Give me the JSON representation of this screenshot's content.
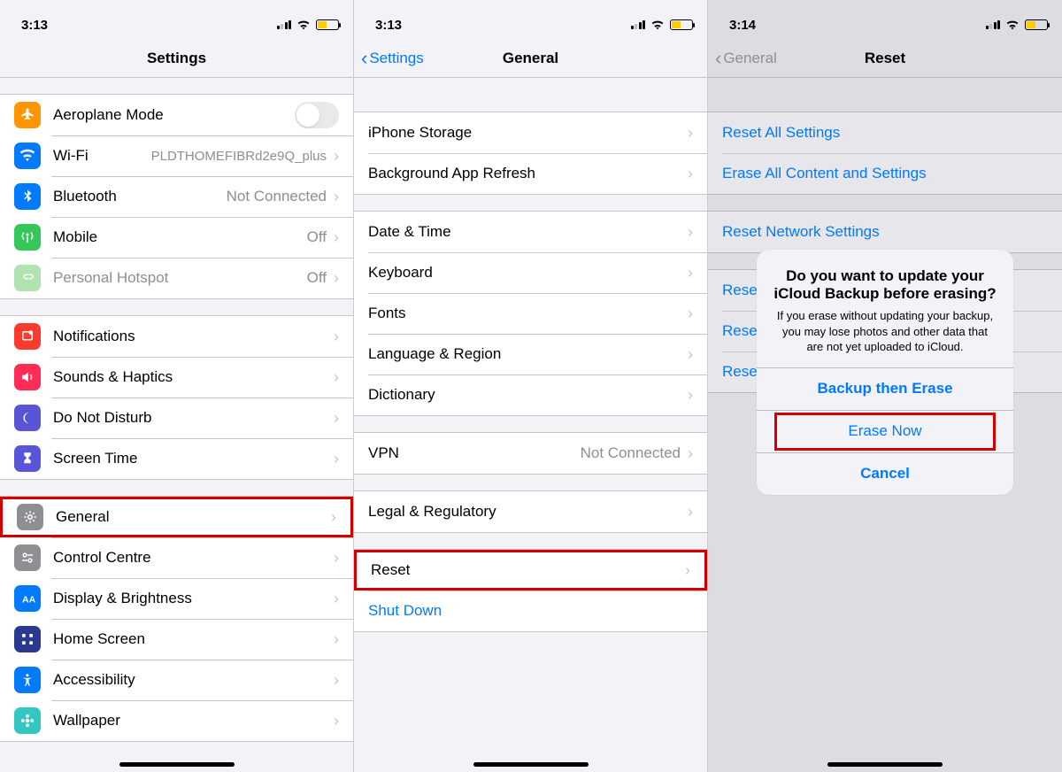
{
  "statusbar": {
    "time1": "3:13",
    "time2": "3:13",
    "time3": "3:14"
  },
  "screen1": {
    "title": "Settings",
    "items": {
      "airplane": "Aeroplane Mode",
      "wifi": "Wi-Fi",
      "wifi_val": "PLDTHOMEFIBRd2e9Q_plus",
      "bt": "Bluetooth",
      "bt_val": "Not Connected",
      "mobile": "Mobile",
      "mobile_val": "Off",
      "hotspot": "Personal Hotspot",
      "hotspot_val": "Off",
      "notif": "Notifications",
      "sounds": "Sounds & Haptics",
      "dnd": "Do Not Disturb",
      "screentime": "Screen Time",
      "general": "General",
      "control": "Control Centre",
      "display": "Display & Brightness",
      "home": "Home Screen",
      "access": "Accessibility",
      "wallpaper": "Wallpaper"
    }
  },
  "screen2": {
    "back": "Settings",
    "title": "General",
    "items": {
      "storage": "iPhone Storage",
      "bgrefresh": "Background App Refresh",
      "datetime": "Date & Time",
      "keyboard": "Keyboard",
      "fonts": "Fonts",
      "lang": "Language & Region",
      "dict": "Dictionary",
      "vpn": "VPN",
      "vpn_val": "Not Connected",
      "legal": "Legal & Regulatory",
      "reset": "Reset",
      "shutdown": "Shut Down"
    }
  },
  "screen3": {
    "back": "General",
    "title": "Reset",
    "items": {
      "all": "Reset All Settings",
      "erase": "Erase All Content and Settings",
      "net": "Reset Network Settings",
      "keyb": "Reset Keyboard Dictionary",
      "home": "Reset Home Screen Layout",
      "loc": "Reset Location & Privacy"
    },
    "alert": {
      "title": "Do you want to update your iCloud Backup before erasing?",
      "desc": "If you erase without updating your backup, you may lose photos and other data that are not yet uploaded to iCloud.",
      "backup": "Backup then Erase",
      "erase": "Erase Now",
      "cancel": "Cancel"
    }
  }
}
